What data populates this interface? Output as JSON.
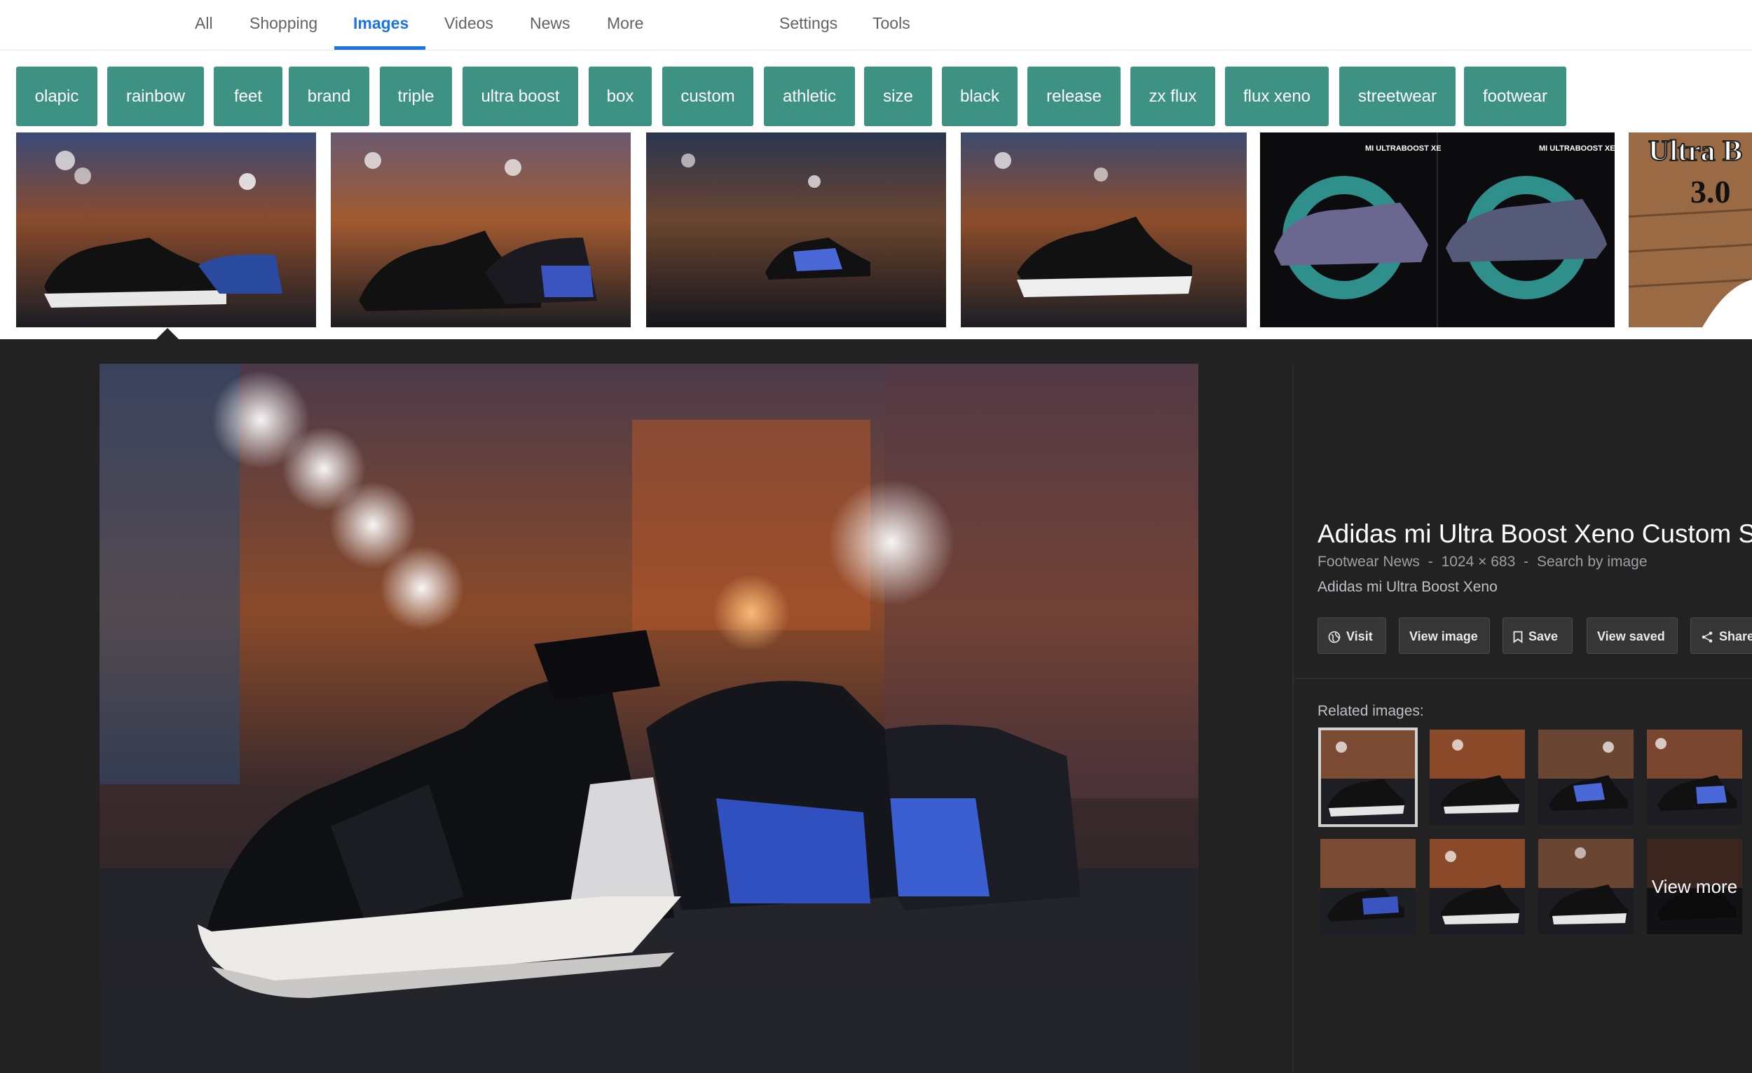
{
  "nav": {
    "tabs": [
      "All",
      "Shopping",
      "Images",
      "Videos",
      "News",
      "More"
    ],
    "active_tab": "Images",
    "settings": "Settings",
    "tools": "Tools"
  },
  "chips": [
    "olapic",
    "rainbow",
    "feet",
    "brand",
    "triple",
    "ultra boost",
    "box",
    "custom",
    "athletic",
    "size",
    "black",
    "release",
    "zx flux",
    "flux xeno",
    "streetwear",
    "footwear"
  ],
  "thumb_texts": {
    "promo_left": "MI ULTRABOOST XE",
    "promo_right": "MI ULTRABOOST XE",
    "partial_title": "Ultra B",
    "partial_version": "3.0"
  },
  "panel": {
    "title": "Adidas mi Ultra Boost Xeno Custom S",
    "source": "Footwear News",
    "dimensions": "1024 × 683",
    "search_by_image": "Search by image",
    "separator": "-",
    "description": "Adidas mi Ultra Boost Xeno",
    "buttons": {
      "visit": "Visit",
      "view_image": "View image",
      "save": "Save",
      "view_saved": "View saved",
      "share": "Share"
    },
    "related_label": "Related images:",
    "view_more": "View more"
  },
  "icons": {
    "visit": "globe-icon",
    "save": "bookmark-icon",
    "share": "share-icon"
  },
  "colors": {
    "chip_bg": "#3e9284",
    "active_tab": "#1a73e8",
    "panel_bg": "#222222"
  }
}
